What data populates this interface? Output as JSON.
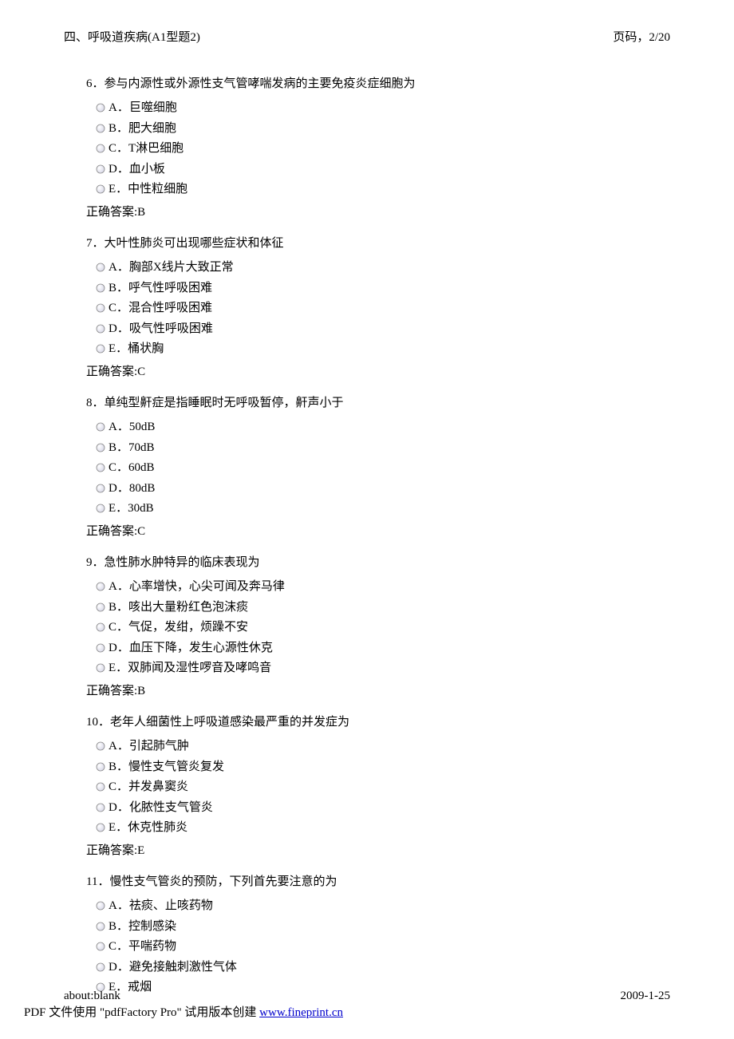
{
  "header": {
    "title": "四、呼吸道疾病(A1型题2)",
    "page_label": "页码，2/20"
  },
  "questions": [
    {
      "number": "6．",
      "stem": "参与内源性或外源性支气管哮喘发病的主要免疫炎症细胞为",
      "options": [
        {
          "label": "A．巨噬细胞"
        },
        {
          "label": "B．肥大细胞"
        },
        {
          "label": "C．T淋巴细胞"
        },
        {
          "label": "D．血小板"
        },
        {
          "label": "E．中性粒细胞"
        }
      ],
      "answer": "正确答案:B"
    },
    {
      "number": "7．",
      "stem": "大叶性肺炎可出现哪些症状和体征",
      "options": [
        {
          "label": "A．胸部X线片大致正常"
        },
        {
          "label": "B．呼气性呼吸困难"
        },
        {
          "label": "C．混合性呼吸困难"
        },
        {
          "label": "D．吸气性呼吸困难"
        },
        {
          "label": "E．桶状胸"
        }
      ],
      "answer": "正确答案:C"
    },
    {
      "number": "8．",
      "stem": "单纯型鼾症是指睡眠时无呼吸暂停，鼾声小于",
      "options": [
        {
          "label": "A．50dB"
        },
        {
          "label": "B．70dB"
        },
        {
          "label": "C．60dB"
        },
        {
          "label": "D．80dB"
        },
        {
          "label": "E．30dB"
        }
      ],
      "answer": "正确答案:C"
    },
    {
      "number": "9．",
      "stem": "急性肺水肿特异的临床表现为",
      "options": [
        {
          "label": "A．心率增快，心尖可闻及奔马律"
        },
        {
          "label": "B．咳出大量粉红色泡沫痰"
        },
        {
          "label": "C．气促，发绀，烦躁不安"
        },
        {
          "label": "D．血压下降，发生心源性休克"
        },
        {
          "label": "E．双肺闻及湿性啰音及哮鸣音"
        }
      ],
      "answer": "正确答案:B"
    },
    {
      "number": "10．",
      "stem": "老年人细菌性上呼吸道感染最严重的并发症为",
      "options": [
        {
          "label": "A．引起肺气肿"
        },
        {
          "label": "B．慢性支气管炎复发"
        },
        {
          "label": "C．并发鼻窦炎"
        },
        {
          "label": "D．化脓性支气管炎"
        },
        {
          "label": "E．休克性肺炎"
        }
      ],
      "answer": "正确答案:E"
    },
    {
      "number": "11．",
      "stem": "慢性支气管炎的预防，下列首先要注意的为",
      "options": [
        {
          "label": "A．祛痰、止咳药物"
        },
        {
          "label": "B．控制感染"
        },
        {
          "label": "C．平喘药物"
        },
        {
          "label": "D．避免接触刺激性气体"
        },
        {
          "label": "E．戒烟"
        }
      ],
      "answer": ""
    }
  ],
  "footer": {
    "left": "about:blank",
    "right": "2009-1-25",
    "watermark_prefix": "PDF 文件使用 \"pdfFactory Pro\" 试用版本创建 ",
    "watermark_link": "www.fineprint.cn"
  }
}
